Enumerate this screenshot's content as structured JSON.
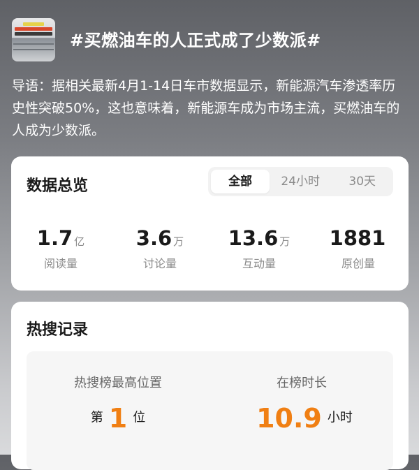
{
  "topic": {
    "title": "#买燃油车的人正式成了少数派#",
    "lead": "导语：据相关最新4月1-14日车市数据显示，新能源汽车渗透率历史性突破50%，这也意味着，新能源车成为市场主流，买燃油车的人成为少数派。"
  },
  "overview": {
    "title": "数据总览",
    "tabs": [
      {
        "label": "全部",
        "active": true
      },
      {
        "label": "24小时",
        "active": false
      },
      {
        "label": "30天",
        "active": false
      }
    ],
    "stats": [
      {
        "value": "1.7",
        "unit": "亿",
        "label": "阅读量"
      },
      {
        "value": "3.6",
        "unit": "万",
        "label": "讨论量"
      },
      {
        "value": "13.6",
        "unit": "万",
        "label": "互动量"
      },
      {
        "value": "1881",
        "unit": "",
        "label": "原创量"
      }
    ]
  },
  "hot": {
    "title": "热搜记录",
    "rank": {
      "label": "热搜榜最高位置",
      "prefix": "第",
      "value": "1",
      "suffix": "位"
    },
    "duration": {
      "label": "在榜时长",
      "value": "10.9",
      "suffix": "小时"
    },
    "accent_color": "#f07f13"
  }
}
